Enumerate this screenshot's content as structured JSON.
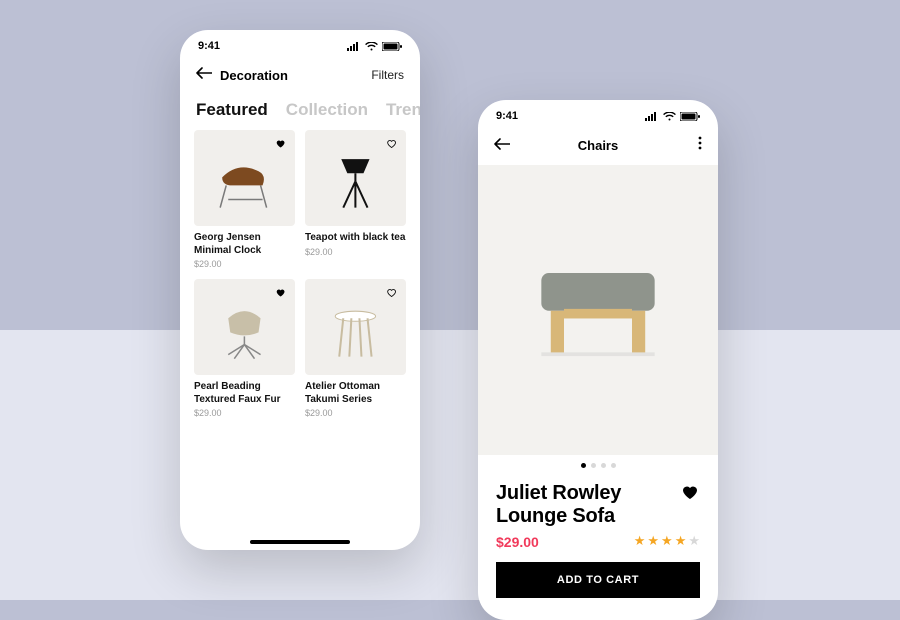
{
  "statusbar": {
    "time": "9:41"
  },
  "listing": {
    "back_icon": "arrow-left",
    "title": "Decoration",
    "filters_label": "Filters",
    "tabs": [
      {
        "label": "Featured",
        "active": true
      },
      {
        "label": "Collection",
        "active": false
      },
      {
        "label": "Trend",
        "active": false
      }
    ],
    "products": [
      {
        "title": "Georg Jensen Minimal Clock",
        "price": "$29.00",
        "favorite": true,
        "icon": "chair"
      },
      {
        "title": "Teapot with black tea",
        "price": "$29.00",
        "favorite": false,
        "icon": "lamp"
      },
      {
        "title": "Pearl Beading Textured Faux Fur",
        "price": "$29.00",
        "favorite": true,
        "icon": "swivel"
      },
      {
        "title": "Atelier Ottoman Takumi Series",
        "price": "$29.00",
        "favorite": false,
        "icon": "table"
      }
    ]
  },
  "detail": {
    "back_icon": "arrow-left",
    "category_title": "Chairs",
    "more_icon": "more-vertical",
    "page_index": 0,
    "page_count": 4,
    "title": "Juliet Rowley Lounge Sofa",
    "price": "$29.00",
    "rating_filled": 4,
    "rating_total": 5,
    "favorite": true,
    "add_to_cart_label": "ADD TO CART"
  }
}
